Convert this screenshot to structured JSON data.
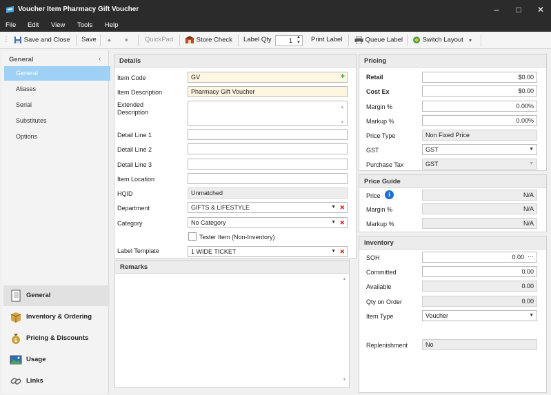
{
  "window": {
    "title": "Voucher Item Pharmacy Gift Voucher"
  },
  "menu": [
    "File",
    "Edit",
    "View",
    "Tools",
    "Help"
  ],
  "toolbar": {
    "save_close": "Save and Close",
    "save": "Save",
    "quickpad": "QuickPad",
    "store_check": "Store Check",
    "label_qty_label": "Label Qty",
    "label_qty_value": "1",
    "print_label": "Print Label",
    "queue_label": "Queue Label",
    "switch_layout": "Switch Layout"
  },
  "leftnav": {
    "header": "General",
    "items": [
      "General",
      "Aliases",
      "Serial",
      "Substitutes",
      "Options"
    ],
    "sections": [
      "General",
      "Inventory & Ordering",
      "Pricing & Discounts",
      "Usage",
      "Links"
    ]
  },
  "details": {
    "title": "Details",
    "item_code_label": "Item Code",
    "item_code": "GV",
    "item_desc_label": "Item Description",
    "item_desc": "Pharmacy Gift Voucher",
    "ext_desc_label1": "Extended",
    "ext_desc_label2": "Description",
    "detail1_label": "Detail Line 1",
    "detail2_label": "Detail Line 2",
    "detail3_label": "Detail Line 3",
    "location_label": "Item Location",
    "hqid_label": "HQID",
    "hqid": "Unmatched",
    "department_label": "Department",
    "department": "GIFTS & LIFESTYLE",
    "category_label": "Category",
    "category": "No Category",
    "tester_label": "Tester Item (Non-Inventory)",
    "label_template_label": "Label Template",
    "label_template": "1 WIDE TICKET"
  },
  "remarks": {
    "title": "Remarks"
  },
  "pricing": {
    "title": "Pricing",
    "retail_label": "Retail",
    "retail": "$0.00",
    "cost_label": "Cost Ex",
    "cost": "$0.00",
    "margin_label": "Margin %",
    "margin": "0.00%",
    "markup_label": "Markup %",
    "markup": "0.00%",
    "price_type_label": "Price Type",
    "price_type": "Non Fixed Price",
    "gst_label": "GST",
    "gst": "GST",
    "purchase_tax_label": "Purchase Tax",
    "purchase_tax": "GST"
  },
  "price_guide": {
    "title": "Price Guide",
    "price_label": "Price",
    "price": "N/A",
    "margin_label": "Margin %",
    "margin": "N/A",
    "markup_label": "Markup %",
    "markup": "N/A"
  },
  "inventory": {
    "title": "Inventory",
    "soh_label": "SOH",
    "soh": "0.00",
    "committed_label": "Committed",
    "committed": "0.00",
    "available_label": "Available",
    "available": "0.00",
    "qty_order_label": "Qty on Order",
    "qty_order": "0.00",
    "item_type_label": "Item Type",
    "item_type": "Voucher",
    "replenishment_label": "Replenishment",
    "replenishment": "No"
  }
}
